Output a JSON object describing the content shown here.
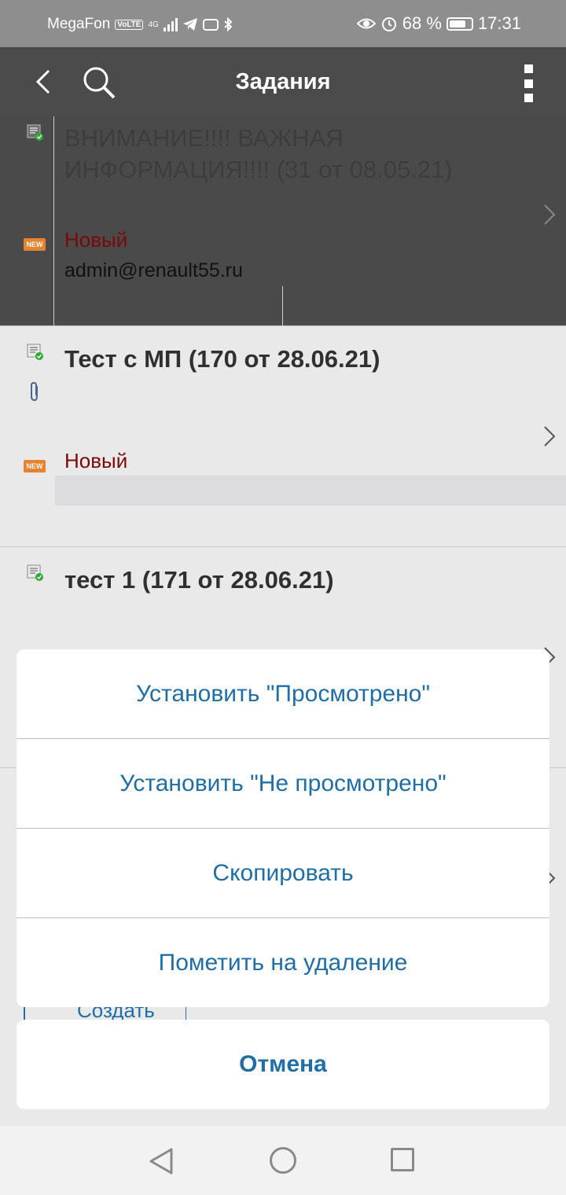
{
  "status_bar": {
    "carrier": "MegaFon",
    "volte": "VoLTE",
    "network": "4G",
    "battery": "68 %",
    "time": "17:31"
  },
  "app_bar": {
    "title": "Задания",
    "icons": [
      "back-icon",
      "search-icon",
      "more-vert-icon"
    ]
  },
  "tasks": [
    {
      "title": "ВНИМАНИЕ!!!! ВАЖНАЯ ИНФОРМАЦИЯ!!!! (31 от 08.05.21)",
      "status": "Новый",
      "author": "admin@renault55.ru",
      "badge": "NEW"
    },
    {
      "title": "Тест с МП (170 от 28.06.21)",
      "status": "Новый",
      "badge": "NEW"
    },
    {
      "title": "тест 1 (171 от 28.06.21)"
    }
  ],
  "action_sheet": {
    "actions": [
      "Установить \"Просмотрено\"",
      "Установить \"Не просмотрено\"",
      "Скопировать",
      "Пометить на удаление"
    ],
    "cancel": "Отмена"
  },
  "partial_button": "Создать",
  "colors": {
    "accent": "#1f6ea8",
    "status_new": "#7a0a0a",
    "app_bar": "#4b4b4b"
  }
}
